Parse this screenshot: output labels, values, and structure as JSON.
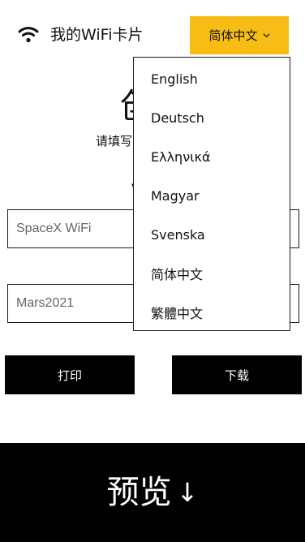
{
  "header": {
    "title": "我的WiFi卡片",
    "language_button": "简体中文",
    "icons": {
      "wifi": "wifi-icon",
      "chevron": "chevron-down-icon"
    },
    "accent_color": "#f7bd14"
  },
  "hero": {
    "title_visible": "创",
    "subtitle_visible": "请填写",
    "partial_heading": "V"
  },
  "form": {
    "ssid_value": "SpaceX WiFi",
    "password_value": "Mars2021"
  },
  "actions": {
    "print_label": "打印",
    "download_label": "下载"
  },
  "preview": {
    "label": "预览",
    "arrow": "↓"
  },
  "language_menu": {
    "items": [
      "English",
      "Deutsch",
      "Ελληνικά",
      "Magyar",
      "Svenska",
      "简体中文",
      "繁體中文"
    ]
  }
}
